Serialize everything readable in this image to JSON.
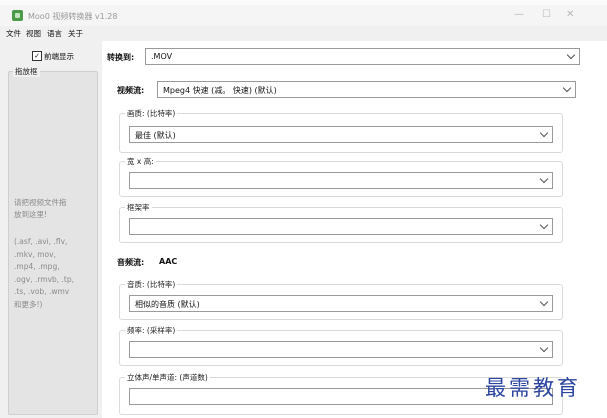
{
  "window": {
    "title": "Moo0 视频转换器 v1.28",
    "minimize_symbol": "—",
    "maximize_symbol": "☐",
    "close_symbol": "✕"
  },
  "menu": [
    "文件",
    "视图",
    "语言",
    "关于"
  ],
  "left": {
    "always_on_top_label": "前端显示",
    "always_on_top_checked": true,
    "check_glyph": "✓",
    "dropbox_legend": "拖放框",
    "drop_hint_lines": [
      "请把视频文件拖",
      "放到这里!"
    ],
    "formats_lines": [
      "(.asf, .avi, .flv,",
      ".mkv, mov,",
      ".mp4, .mpg,",
      ".ogv, .rmvb, .tp,",
      ".ts, .vob, .wmv",
      "和更多!)"
    ]
  },
  "convert": {
    "label": "转换到:",
    "value": ".MOV"
  },
  "video": {
    "label": "视频流:",
    "codec_value": "Mpeg4  快速        (减。   快速)   (默认)",
    "quality_title": "画质:  (比特率)",
    "quality_value": "最佳  (默认)",
    "size_title": "宽 x 高:",
    "size_value": "",
    "framerate_title": "框架率",
    "framerate_value": ""
  },
  "audio": {
    "label": "音频流:",
    "codec": "AAC",
    "quality_title": "音质:  (比特率)",
    "quality_value": "相似的音质  (默认)",
    "frequency_title": "频率:  (采样率)",
    "frequency_value": "",
    "channels_title": "立体声/单声道:    (声道数)",
    "channels_value": ""
  },
  "watermark": "最需教育",
  "colors": {
    "accent_icon": "#4a9a4a",
    "watermark": "#2c46a0"
  }
}
